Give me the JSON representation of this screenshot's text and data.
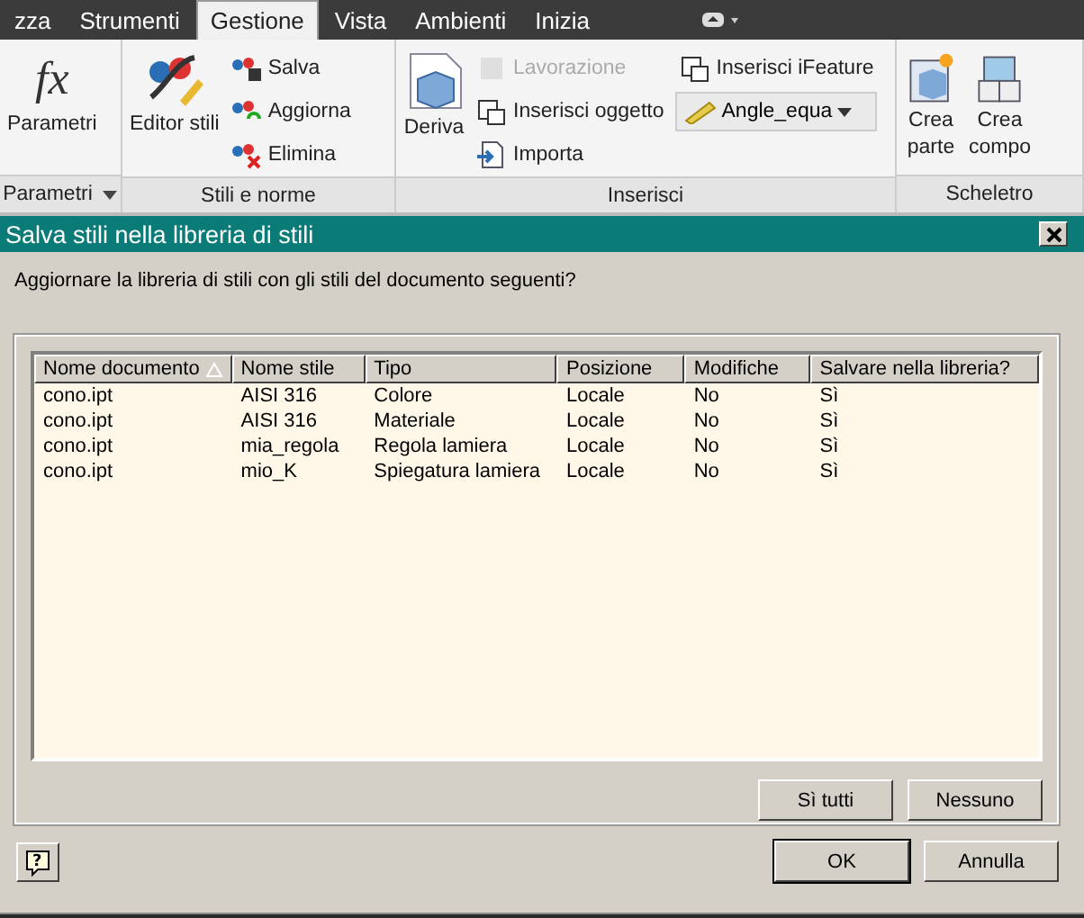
{
  "ribbon_tabs": [
    {
      "label": "zza",
      "selected": false
    },
    {
      "label": "Strumenti",
      "selected": false
    },
    {
      "label": "Gestione",
      "selected": true
    },
    {
      "label": "Vista",
      "selected": false
    },
    {
      "label": "Ambienti",
      "selected": false
    },
    {
      "label": "Inizia",
      "selected": false
    }
  ],
  "ribbon_panels": [
    {
      "title": "Parametri",
      "items": [
        {
          "kind": "large",
          "icon_text": "fx",
          "label": "Parametri"
        }
      ]
    },
    {
      "title": "Stili e norme",
      "items": [
        {
          "kind": "large",
          "label": "Editor stili"
        },
        {
          "kind": "small",
          "label": "Salva",
          "disabled": false
        },
        {
          "kind": "small",
          "label": "Aggiorna",
          "disabled": false
        },
        {
          "kind": "small",
          "label": "Elimina",
          "disabled": false
        }
      ]
    },
    {
      "title": "Inserisci",
      "items": [
        {
          "kind": "large",
          "label": "Deriva"
        },
        {
          "kind": "small",
          "label": "Lavorazione",
          "disabled": true
        },
        {
          "kind": "small",
          "label": "Inserisci oggetto",
          "disabled": false
        },
        {
          "kind": "small",
          "label": "Importa",
          "disabled": false
        },
        {
          "kind": "small",
          "label": "Inserisci iFeature",
          "disabled": false
        },
        {
          "kind": "dropdown",
          "label": "Angle_equa"
        }
      ]
    },
    {
      "title": "Scheletro",
      "items": [
        {
          "kind": "large",
          "label": "Crea\nparte"
        },
        {
          "kind": "large",
          "label": "Crea\ncompo"
        }
      ]
    }
  ],
  "dialog": {
    "title": "Salva stili nella libreria di stili",
    "prompt": "Aggiornare la libreria di stili con gli stili del documento seguenti?",
    "table": {
      "columns": [
        {
          "label": "Nome documento",
          "sorted": true
        },
        {
          "label": "Nome stile",
          "sorted": false
        },
        {
          "label": "Tipo",
          "sorted": false
        },
        {
          "label": "Posizione",
          "sorted": false
        },
        {
          "label": "Modifiche",
          "sorted": false
        },
        {
          "label": "Salvare nella libreria?",
          "sorted": false
        }
      ],
      "rows": [
        [
          "cono.ipt",
          "AISI 316",
          "Colore",
          "Locale",
          "No",
          "Sì"
        ],
        [
          "cono.ipt",
          "AISI 316",
          "Materiale",
          "Locale",
          "No",
          "Sì"
        ],
        [
          "cono.ipt",
          "mia_regola",
          "Regola lamiera",
          "Locale",
          "No",
          "Sì"
        ],
        [
          "cono.ipt",
          "mio_K",
          "Spiegatura lamiera",
          "Locale",
          "No",
          "Sì"
        ]
      ]
    },
    "table_buttons": [
      "Sì tutti",
      "Nessuno"
    ],
    "help_label": "?",
    "buttons": [
      {
        "label": "OK",
        "default": true
      },
      {
        "label": "Annulla",
        "default": false
      }
    ]
  }
}
